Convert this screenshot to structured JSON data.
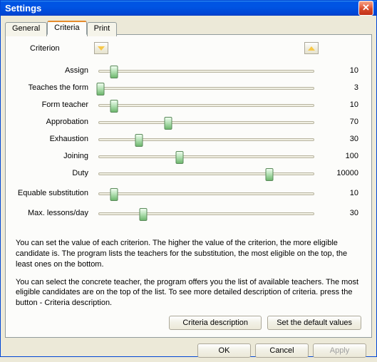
{
  "window": {
    "title": "Settings"
  },
  "tabs": {
    "general": "General",
    "criteria": "Criteria",
    "print": "Print",
    "active": "criteria"
  },
  "header": {
    "criterion_label": "Criterion"
  },
  "criteria": [
    {
      "name": "Assign",
      "value": 10,
      "pos": 9
    },
    {
      "name": "Teaches the form",
      "value": 3,
      "pos": 3
    },
    {
      "name": "Form teacher",
      "value": 10,
      "pos": 9
    },
    {
      "name": "Approbation",
      "value": 70,
      "pos": 33
    },
    {
      "name": "Exhaustion",
      "value": 30,
      "pos": 20
    },
    {
      "name": "Joining",
      "value": 100,
      "pos": 38
    },
    {
      "name": "Duty",
      "value": 10000,
      "pos": 78
    },
    {
      "name": "Equable substitution",
      "value": 10,
      "pos": 9,
      "tall": true
    },
    {
      "name": "Max. lessons/day",
      "value": 30,
      "pos": 22
    }
  ],
  "description": {
    "p1": "You can set the value of each criterion. The higher the value of the criterion, the more eligible candidate is. The program lists the teachers for the substitution, the most eligible on the top, the least ones on the bottom.",
    "p2": "You can select the concrete teacher, the program offers you the list of available teachers. The most eligible candidates are on the top of the list. To see more detailed description of criteria. press the button - Criteria description."
  },
  "buttons": {
    "criteria_description": "Criteria description",
    "set_defaults": "Set the default values",
    "ok": "OK",
    "cancel": "Cancel",
    "apply": "Apply"
  }
}
